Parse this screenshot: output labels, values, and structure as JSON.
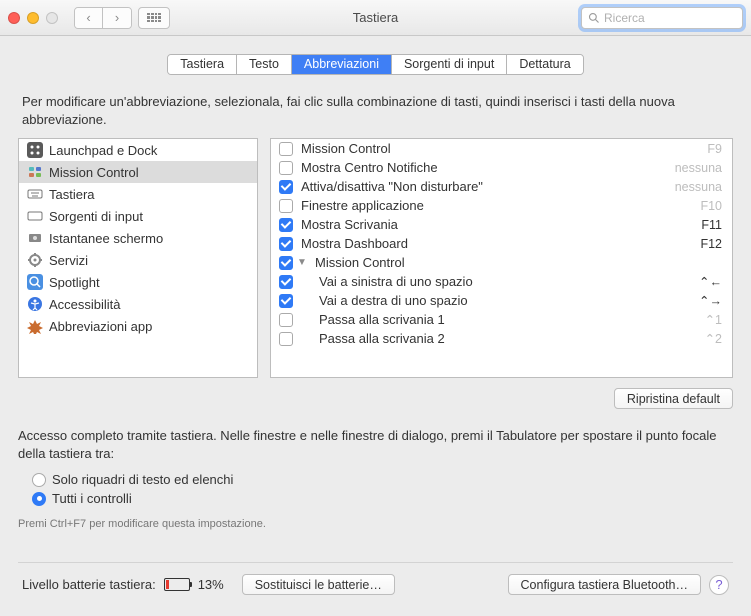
{
  "window": {
    "title": "Tastiera",
    "search_placeholder": "Ricerca"
  },
  "tabs": [
    {
      "label": "Tastiera"
    },
    {
      "label": "Testo"
    },
    {
      "label": "Abbreviazioni",
      "active": true
    },
    {
      "label": "Sorgenti di input"
    },
    {
      "label": "Dettatura"
    }
  ],
  "description": "Per modificare un'abbreviazione, selezionala, fai clic sulla combinazione di tasti, quindi inserisci i tasti della nuova abbreviazione.",
  "sidebar": [
    {
      "label": "Launchpad e Dock",
      "icon": "launchpad"
    },
    {
      "label": "Mission Control",
      "icon": "mission",
      "selected": true
    },
    {
      "label": "Tastiera",
      "icon": "keyboard"
    },
    {
      "label": "Sorgenti di input",
      "icon": "input"
    },
    {
      "label": "Istantanee schermo",
      "icon": "screenshot"
    },
    {
      "label": "Servizi",
      "icon": "services"
    },
    {
      "label": "Spotlight",
      "icon": "spotlight"
    },
    {
      "label": "Accessibilità",
      "icon": "accessibility"
    },
    {
      "label": "Abbreviazioni app",
      "icon": "app"
    }
  ],
  "shortcuts": [
    {
      "label": "Mission Control",
      "checked": false,
      "key": "F9",
      "key_dim": true
    },
    {
      "label": "Mostra Centro Notifiche",
      "checked": false,
      "key": "nessuna",
      "key_dim": true
    },
    {
      "label": "Attiva/disattiva \"Non disturbare\"",
      "checked": true,
      "key": "nessuna",
      "key_dim": true
    },
    {
      "label": "Finestre applicazione",
      "checked": false,
      "key": "F10",
      "key_dim": true
    },
    {
      "label": "Mostra Scrivania",
      "checked": true,
      "key": "F11",
      "key_dim": false
    },
    {
      "label": "Mostra Dashboard",
      "checked": true,
      "key": "F12",
      "key_dim": false
    },
    {
      "label": "Mission Control",
      "checked": true,
      "group": true
    },
    {
      "label": "Vai a sinistra di uno spazio",
      "checked": true,
      "key": "⌃←",
      "key_dim": false,
      "indent": true
    },
    {
      "label": "Vai a destra di uno spazio",
      "checked": true,
      "key": "⌃→",
      "key_dim": false,
      "indent": true
    },
    {
      "label": "Passa alla scrivania 1",
      "checked": false,
      "key": "⌃1",
      "key_dim": true,
      "indent": true
    },
    {
      "label": "Passa alla scrivania 2",
      "checked": false,
      "key": "⌃2",
      "key_dim": true,
      "indent": true
    }
  ],
  "restore_button": "Ripristina default",
  "access_text": "Accesso completo tramite tastiera. Nelle finestre e nelle finestre di dialogo, premi il Tabulatore per spostare il punto focale della tastiera tra:",
  "radios": [
    {
      "label": "Solo riquadri di testo ed elenchi",
      "on": false
    },
    {
      "label": "Tutti i controlli",
      "on": true
    }
  ],
  "hint": "Premi Ctrl+F7 per modificare questa impostazione.",
  "footer": {
    "battery_label": "Livello batterie tastiera:",
    "battery_pct": "13%",
    "replace_btn": "Sostituisci le batterie…",
    "configure_btn": "Configura tastiera Bluetooth…"
  }
}
